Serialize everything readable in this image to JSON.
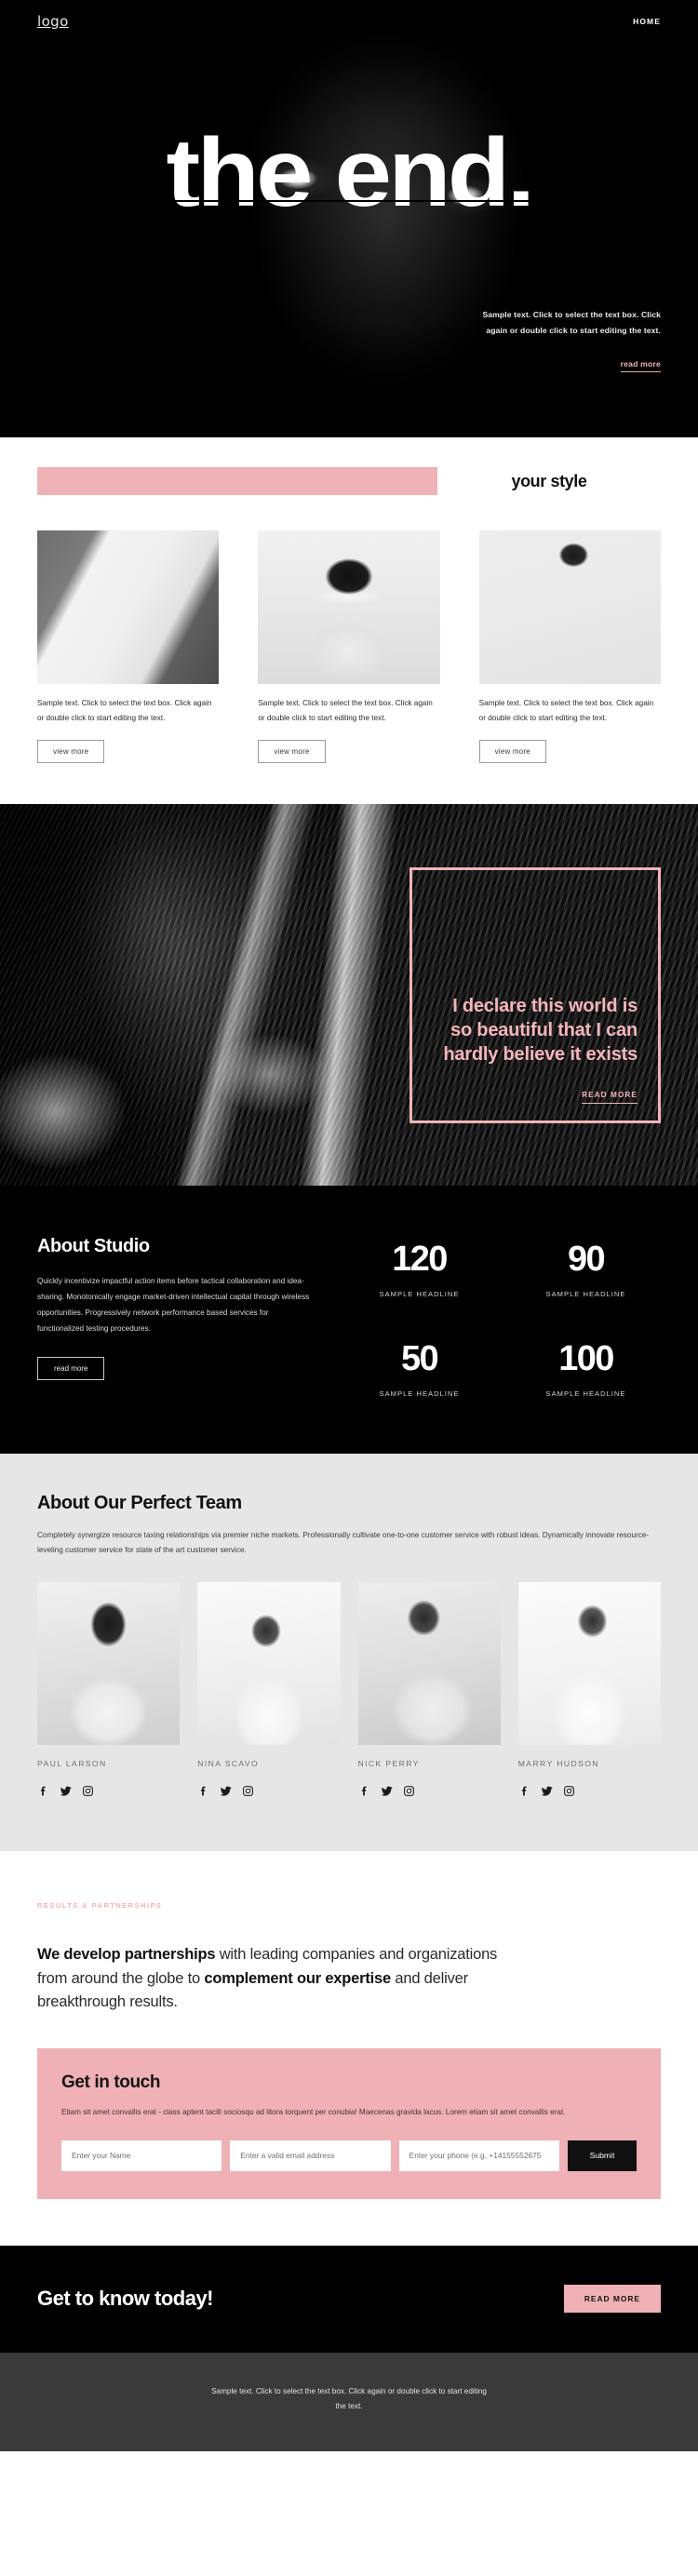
{
  "header": {
    "logo": "logo",
    "nav": [
      {
        "label": "HOME"
      }
    ]
  },
  "hero": {
    "title": "the end.",
    "aside_text": "Sample text. Click to select the text box. Click again or double click to start editing the text.",
    "read_more": "read more",
    "image_alt": "close-up-face-portrait"
  },
  "style": {
    "title": "your style",
    "accent_color": "#EFB2B6",
    "cards": [
      {
        "image_alt": "woman-in-white-dress-on-street",
        "text": "Sample text. Click to select the text box. Click again or double click to start editing the text.",
        "button": "view more"
      },
      {
        "image_alt": "man-covering-eyes-with-cloth",
        "text": "Sample text. Click to select the text box. Click again or double click to start editing the text.",
        "button": "view more"
      },
      {
        "image_alt": "woman-walking-in-white-outfit",
        "text": "Sample text. Click to select the text box. Click again or double click to start editing the text.",
        "button": "view more"
      }
    ]
  },
  "quote": {
    "image_alt": "antelope-canyon-rock-formation",
    "text": "I declare this world is so beautiful that I can hardly believe it exists",
    "cta": "READ MORE",
    "border_color": "#F3B3B8"
  },
  "about": {
    "heading": "About Studio",
    "paragraph": "Quickly incentivize impactful action items before tactical collaboration and idea-sharing. Monotonically engage market-driven intellectual capital through wireless opportunities. Progressively network performance based services for functionalized testing procedures.",
    "button": "read more",
    "stats": [
      {
        "value": "120",
        "label": "SAMPLE HEADLINE"
      },
      {
        "value": "90",
        "label": "SAMPLE HEADLINE"
      },
      {
        "value": "50",
        "label": "SAMPLE HEADLINE"
      },
      {
        "value": "100",
        "label": "SAMPLE HEADLINE"
      }
    ]
  },
  "team": {
    "heading": "About Our Perfect Team",
    "paragraph": "Completely synergize resource taxing relationships via premier niche markets. Professionally cultivate one-to-one customer service with robust ideas. Dynamically innovate resource-leveling customer service for state of the art customer service.",
    "members": [
      {
        "name": "PAUL LARSON",
        "image_alt": "portrait-man-white-tshirt"
      },
      {
        "name": "NINA SCAVO",
        "image_alt": "portrait-woman-smiling"
      },
      {
        "name": "NICK PERRY",
        "image_alt": "portrait-man-tattoos-sitting"
      },
      {
        "name": "MARRY HUDSON",
        "image_alt": "portrait-woman-hand-on-head"
      }
    ],
    "social_icons": [
      "facebook-icon",
      "twitter-icon",
      "instagram-icon"
    ]
  },
  "partnerships": {
    "eyebrow": "RESULTS & PARTNERSHIPS",
    "line1_strong": "We develop partnerships",
    "line1_rest": " with leading companies and",
    "line2_rest": "organizations from around the globe to ",
    "line2_strong": "complement",
    "line3_strong": "our expertise",
    "line3_rest": " and deliver breakthrough results."
  },
  "contact": {
    "heading": "Get in touch",
    "paragraph": "Etiam sit amet convallis erat - class aptent taciti sociosqu ad litora torquent per conubia! Maecenas gravida lacus. Lorem etiam sit amet convallis erat.",
    "name_placeholder": "Enter your Name",
    "email_placeholder": "Enter a valid email address",
    "phone_placeholder": "Enter your phone (e.g. +14155552675",
    "submit_label": "Submit",
    "background_color": "#EFB1B5"
  },
  "cta": {
    "heading": "Get to know today!",
    "button": "READ MORE"
  },
  "footer": {
    "text": "Sample text. Click to select the text box. Click again or double click to start editing the text."
  }
}
